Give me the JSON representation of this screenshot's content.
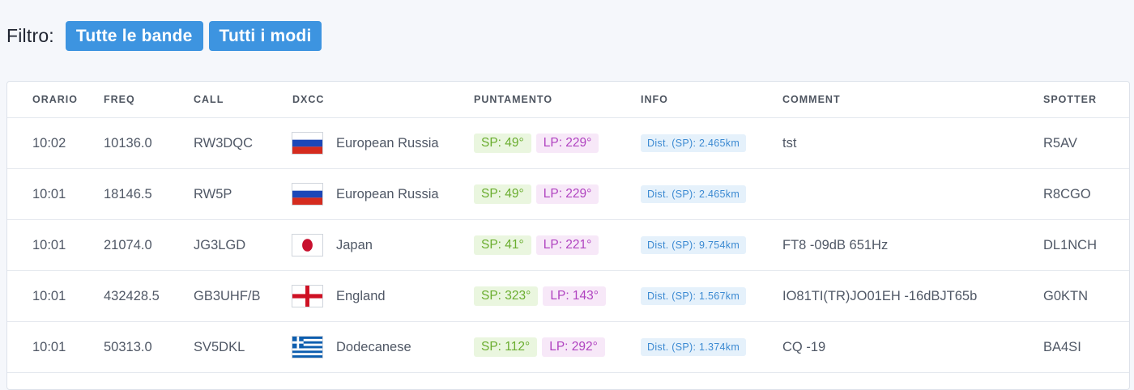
{
  "filter": {
    "label": "Filtro:",
    "bands_button": "Tutte le bande",
    "modes_button": "Tutti i modi"
  },
  "table": {
    "headers": {
      "orario": "ORARIO",
      "freq": "FREQ",
      "call": "CALL",
      "dxcc": "DXCC",
      "puntamento": "PUNTAMENTO",
      "info": "INFO",
      "comment": "COMMENT",
      "spotter": "SPOTTER"
    },
    "rows": [
      {
        "time": "10:02",
        "freq": "10136.0",
        "call": "RW3DQC",
        "flag": "russia-flag-icon",
        "dxcc": "European Russia",
        "sp": "SP: 49°",
        "lp": "LP: 229°",
        "dist": "Dist. (SP): 2.465km",
        "comment": "tst",
        "spotter": "R5AV"
      },
      {
        "time": "10:01",
        "freq": "18146.5",
        "call": "RW5P",
        "flag": "russia-flag-icon",
        "dxcc": "European Russia",
        "sp": "SP: 49°",
        "lp": "LP: 229°",
        "dist": "Dist. (SP): 2.465km",
        "comment": "",
        "spotter": "R8CGO"
      },
      {
        "time": "10:01",
        "freq": "21074.0",
        "call": "JG3LGD",
        "flag": "japan-flag-icon",
        "dxcc": "Japan",
        "sp": "SP: 41°",
        "lp": "LP: 221°",
        "dist": "Dist. (SP): 9.754km",
        "comment": "FT8 -09dB 651Hz",
        "spotter": "DL1NCH"
      },
      {
        "time": "10:01",
        "freq": "432428.5",
        "call": "GB3UHF/B",
        "flag": "england-flag-icon",
        "dxcc": "England",
        "sp": "SP: 323°",
        "lp": "LP: 143°",
        "dist": "Dist. (SP): 1.567km",
        "comment": "IO81TI(TR)JO01EH -16dBJT65b",
        "spotter": "G0KTN"
      },
      {
        "time": "10:01",
        "freq": "50313.0",
        "call": "SV5DKL",
        "flag": "greece-flag-icon",
        "dxcc": "Dodecanese",
        "sp": "SP: 112°",
        "lp": "LP: 292°",
        "dist": "Dist. (SP): 1.374km",
        "comment": "CQ -19",
        "spotter": "BA4SI"
      }
    ]
  }
}
